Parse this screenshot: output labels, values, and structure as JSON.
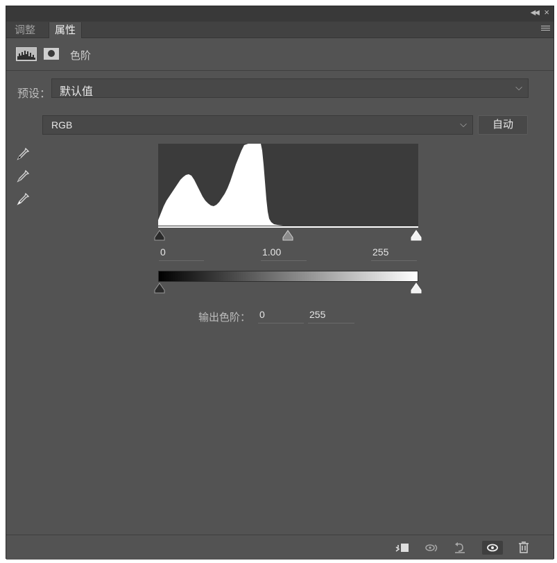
{
  "tabs": [
    {
      "label": "调整",
      "active": false
    },
    {
      "label": "属性",
      "active": true
    }
  ],
  "header": {
    "title": "色阶"
  },
  "preset": {
    "label": "预设：",
    "value": "默认值"
  },
  "channel": {
    "value": "RGB"
  },
  "auto_button": "自动",
  "input_levels": {
    "black": "0",
    "gamma": "1.00",
    "white": "255"
  },
  "output_levels": {
    "label": "输出色阶：",
    "black": "0",
    "white": "255"
  },
  "icons": {
    "collapse": "double-chevron-left-icon",
    "close": "close-icon",
    "menu": "panel-menu-icon",
    "eyedroppers": [
      "black-point-eyedropper-icon",
      "gray-point-eyedropper-icon",
      "white-point-eyedropper-icon"
    ],
    "bottom": [
      "clip-to-layer-icon",
      "view-previous-state-icon",
      "reset-icon",
      "visibility-eye-icon",
      "delete-icon"
    ]
  },
  "colors": {
    "panel": "#535353",
    "tabbar": "#424242",
    "histogram_bg": "#3b3b3b",
    "histogram_fill": "#ffffff"
  }
}
